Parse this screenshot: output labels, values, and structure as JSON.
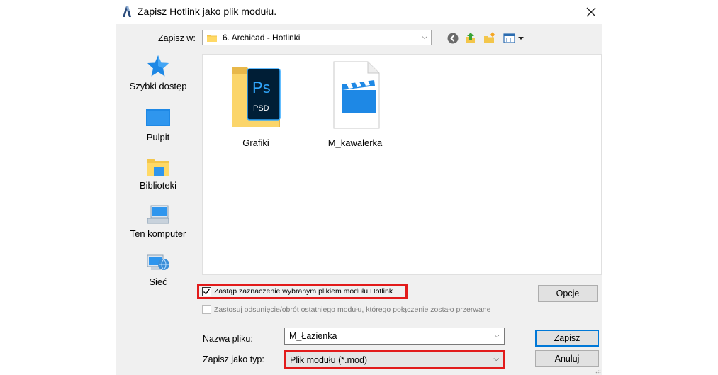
{
  "window": {
    "title": "Zapisz Hotlink jako plik modułu."
  },
  "location": {
    "label": "Zapisz w:",
    "value": "6. Archicad - Hotlinki"
  },
  "toolbar": {
    "back": "back-icon",
    "up": "up-folder-icon",
    "new_folder": "new-folder-icon",
    "view_menu": "view-menu-icon"
  },
  "places": [
    {
      "label": "Szybki dostęp",
      "icon": "star-icon"
    },
    {
      "label": "Pulpit",
      "icon": "desktop-icon"
    },
    {
      "label": "Biblioteki",
      "icon": "libraries-icon"
    },
    {
      "label": "Ten komputer",
      "icon": "computer-icon"
    },
    {
      "label": "Sieć",
      "icon": "network-icon"
    }
  ],
  "files": [
    {
      "name": "Grafiki",
      "icon": "photoshop-folder-icon"
    },
    {
      "name": "M_kawalerka",
      "icon": "video-file-icon"
    }
  ],
  "options": {
    "replace_label": "Zastąp zaznaczenie wybranym plikiem modułu Hotlink",
    "replace_checked": true,
    "apply_label": "Zastosuj odsunięcie/obrót ostatniego modułu, którego połączenie zostało przerwane",
    "apply_checked": false,
    "apply_enabled": false
  },
  "form": {
    "filename_label": "Nazwa pliku:",
    "filename_value": "M_Łazienka",
    "filetype_label": "Zapisz jako typ:",
    "filetype_value": "Plik modułu (*.mod)"
  },
  "buttons": {
    "options": "Opcje",
    "save": "Zapisz",
    "cancel": "Anuluj"
  },
  "colors": {
    "highlight": "#e21b1b",
    "primary_border": "#0078d7"
  }
}
